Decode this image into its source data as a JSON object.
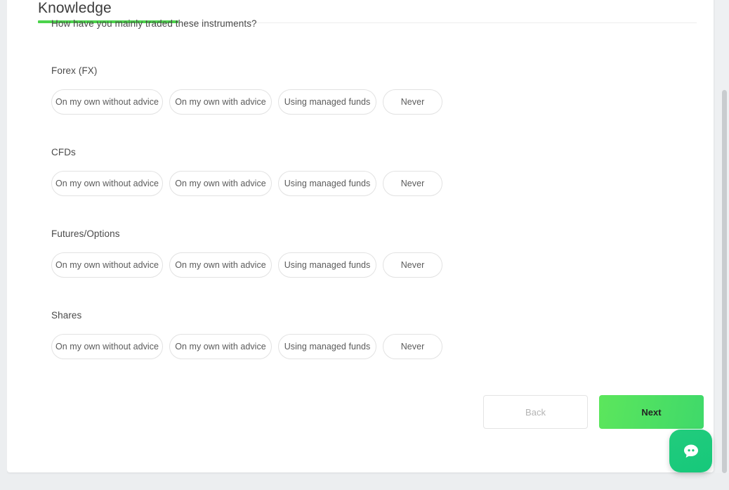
{
  "header": {
    "tab_label": "Knowledge",
    "accent_color": "#4bd34b"
  },
  "main": {
    "question": "How have you mainly traded these instruments?",
    "groups": [
      {
        "label": "Forex (FX)",
        "options": [
          "On my own without advice",
          "On my own with advice",
          "Using managed funds",
          "Never"
        ]
      },
      {
        "label": "CFDs",
        "options": [
          "On my own without advice",
          "On my own with advice",
          "Using managed funds",
          "Never"
        ]
      },
      {
        "label": "Futures/Options",
        "options": [
          "On my own without advice",
          "On my own with advice",
          "Using managed funds",
          "Never"
        ]
      },
      {
        "label": "Shares",
        "options": [
          "On my own without advice",
          "On my own with advice",
          "Using managed funds",
          "Never"
        ]
      }
    ]
  },
  "footer": {
    "back_label": "Back",
    "next_label": "Next",
    "next_color": "#4ce062"
  },
  "chat": {
    "icon": "chat-bubble-icon",
    "color": "#1fc97a"
  }
}
